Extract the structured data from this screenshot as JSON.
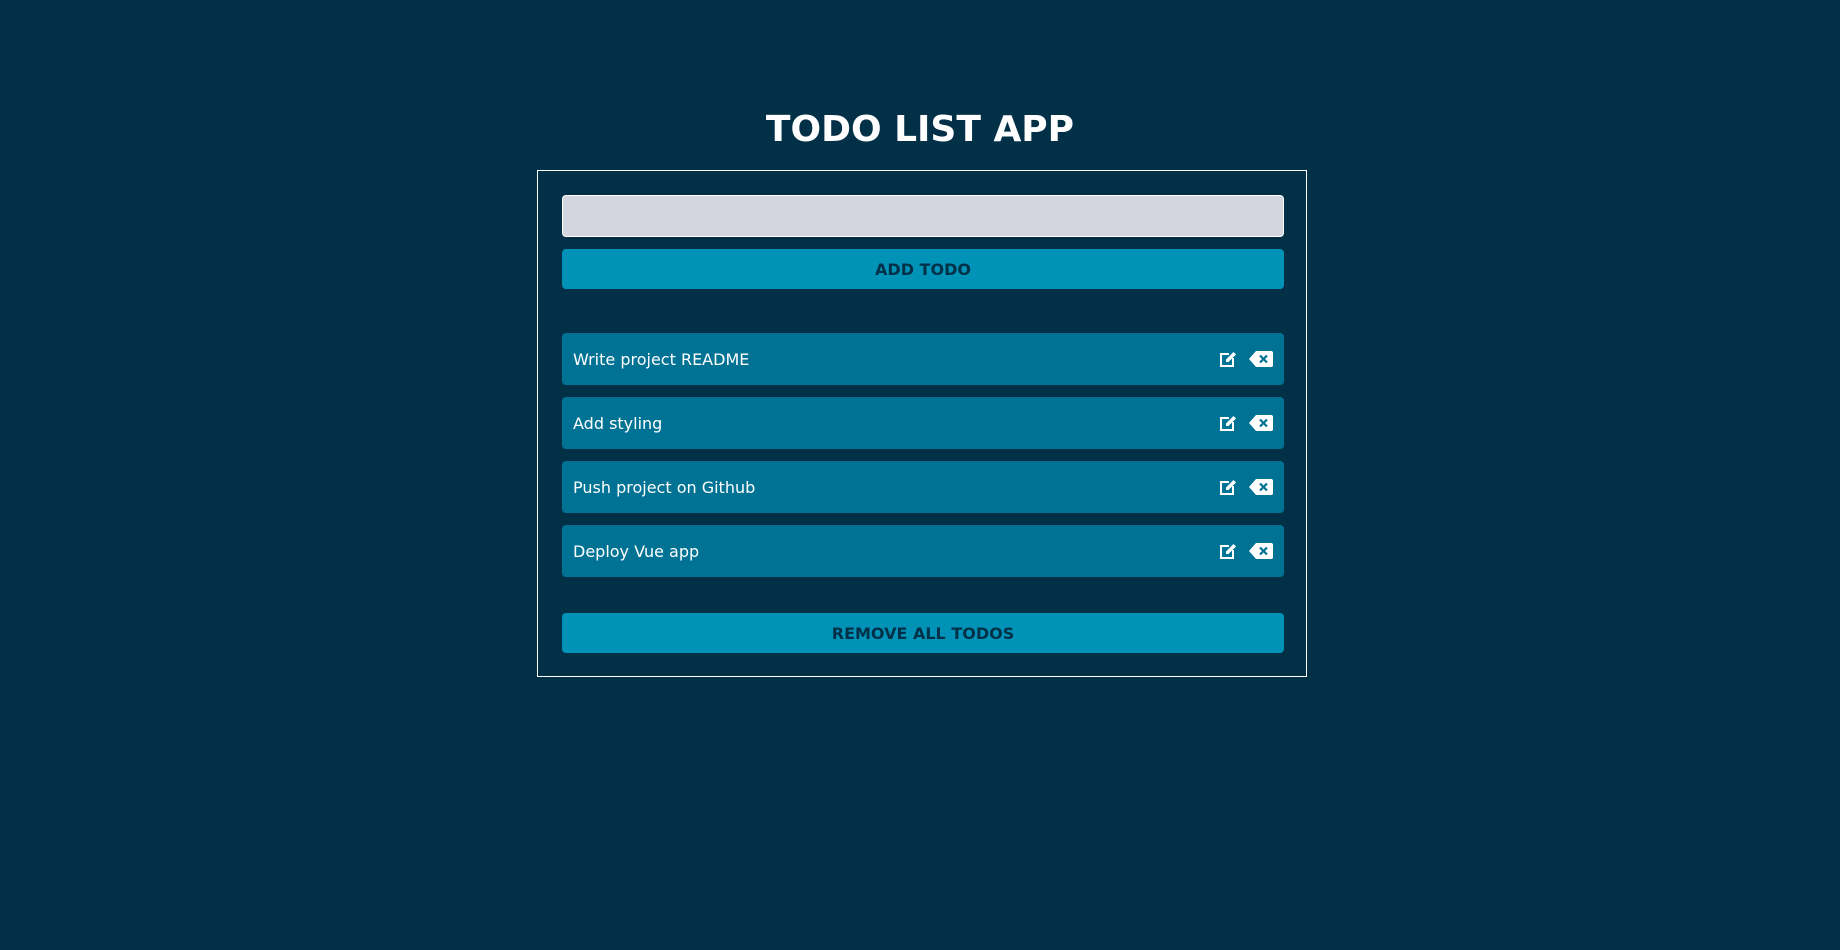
{
  "app": {
    "title": "TODO LIST APP"
  },
  "form": {
    "input_value": "",
    "input_placeholder": "",
    "add_label": "ADD TODO"
  },
  "todos": [
    {
      "text": "Write project README"
    },
    {
      "text": "Add styling"
    },
    {
      "text": "Push project on Github"
    },
    {
      "text": "Deploy Vue app"
    }
  ],
  "actions": {
    "remove_all_label": "REMOVE ALL TODOS"
  },
  "icons": {
    "edit": "edit-icon",
    "delete": "backspace-delete-icon"
  },
  "colors": {
    "background": "#023047",
    "button": "#0093b7",
    "item": "#007294",
    "input": "#d3d6de",
    "text": "#ffffff"
  }
}
